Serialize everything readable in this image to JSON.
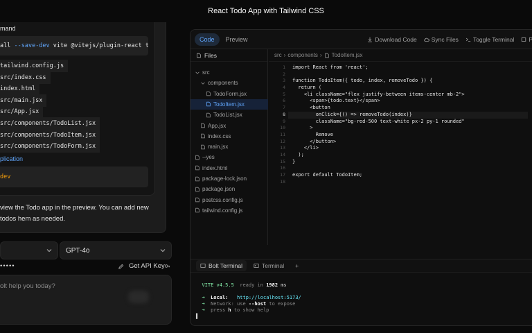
{
  "window": {
    "title": "React Todo App with Tailwind CSS"
  },
  "chat": {
    "command_heading": "mand",
    "npm_prefix": "all ",
    "npm_flag": "--save-dev",
    "npm_rest": " vite @vitejs/plugin-react tailwindc",
    "files": [
      "tailwind.config.js",
      "src/index.css",
      "index.html",
      "src/main.jsx",
      "src/App.jsx",
      "src/components/TodoList.jsx",
      "src/components/TodoItem.jsx",
      "src/components/TodoForm.jsx"
    ],
    "application_link": "plication",
    "dev_command": "dev",
    "preview_text": "view the Todo app in the preview. You can add new todos hem as needed.",
    "provider_select": "",
    "model_select": "GPT-4o",
    "api_key_masked": "•••••",
    "get_api_key": "Get API Key",
    "prompt_placeholder": "olt help you today?"
  },
  "workbench": {
    "tabs": [
      "Code",
      "Preview"
    ],
    "actions": {
      "download": "Download Code",
      "sync": "Sync Files",
      "toggle": "Toggle Terminal",
      "cut": "P"
    },
    "files_header": "Files",
    "tree": [
      {
        "name": "src",
        "type": "folder-open"
      },
      {
        "name": "components",
        "type": "folder-open"
      },
      {
        "name": "TodoForm.jsx",
        "type": "file"
      },
      {
        "name": "TodoItem.jsx",
        "type": "file",
        "active": true
      },
      {
        "name": "TodoList.jsx",
        "type": "file"
      },
      {
        "name": "App.jsx",
        "type": "file"
      },
      {
        "name": "index.css",
        "type": "file"
      },
      {
        "name": "main.jsx",
        "type": "file"
      },
      {
        "name": "--yes",
        "type": "file"
      },
      {
        "name": "index.html",
        "type": "file"
      },
      {
        "name": "package-lock.json",
        "type": "file"
      },
      {
        "name": "package.json",
        "type": "file"
      },
      {
        "name": "postcss.config.js",
        "type": "file"
      },
      {
        "name": "tailwind.config.js",
        "type": "file"
      }
    ],
    "breadcrumb": [
      "src",
      "components",
      "TodoItem.jsx"
    ],
    "current_line": 8,
    "code_lines": [
      "import React from 'react';",
      "",
      "function TodoItem({ todo, index, removeTodo }) {",
      "  return (",
      "    <li className=\"flex justify-between items-center mb-2\">",
      "      <span>{todo.text}</span>",
      "      <button",
      "        onClick={() => removeTodo(index)}",
      "        className=\"bg-red-500 text-white px-2 py-1 rounded\"",
      "      >",
      "        Remove",
      "      </button>",
      "    </li>",
      "  );",
      "}",
      "",
      "export default TodoItem;",
      ""
    ],
    "terminal_tabs": [
      "Bolt Terminal",
      "Terminal"
    ],
    "add_terminal": "+",
    "terminal": {
      "vite": "VITE",
      "version": "v4.5.5",
      "ready_label": "ready in",
      "ready_ms": "1982",
      "ms": "ms",
      "local_label": "Local:",
      "local_url": "http://localhost:5173/",
      "network_line_a": "Network: use ",
      "network_flag": "--host",
      "network_line_b": " to expose",
      "help_a": "press ",
      "help_key": "h",
      "help_b": " to show help",
      "cursor": "▌"
    }
  }
}
